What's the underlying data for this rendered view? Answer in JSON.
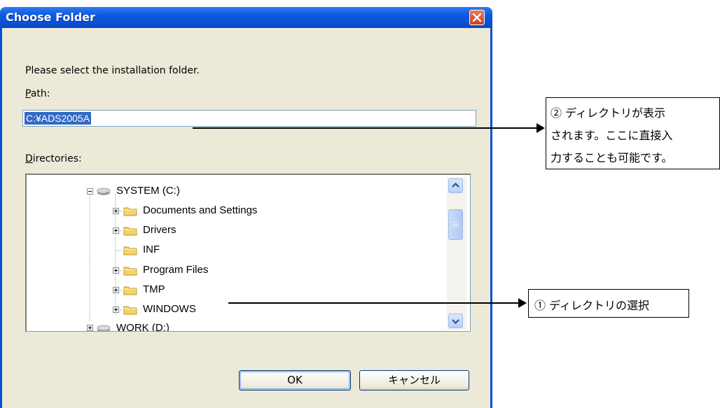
{
  "dialog": {
    "title": "Choose Folder",
    "prompt": "Please select the installation folder.",
    "path_label_accel": "P",
    "path_label_rest": "ath:",
    "path_value": "C:¥ADS2005A",
    "dirs_label_accel": "D",
    "dirs_label_rest": "irectories:",
    "tree": [
      {
        "label": "SYSTEM (C:)",
        "type": "drive",
        "expander": "minus"
      },
      {
        "label": "Documents and Settings",
        "type": "folder",
        "expander": "plus"
      },
      {
        "label": "Drivers",
        "type": "folder",
        "expander": "plus"
      },
      {
        "label": "INF",
        "type": "folder",
        "expander": "none"
      },
      {
        "label": "Program Files",
        "type": "folder",
        "expander": "plus"
      },
      {
        "label": "TMP",
        "type": "folder",
        "expander": "plus"
      },
      {
        "label": "WINDOWS",
        "type": "folder",
        "expander": "plus"
      },
      {
        "label": "WORK (D:)",
        "type": "drive",
        "expander": "plus"
      }
    ],
    "ok_label": "OK",
    "cancel_label": "キャンセル"
  },
  "annotations": {
    "callout_path": [
      "② ディレクトリが表示",
      "されます。ここに直接入",
      "力することも可能です。"
    ],
    "callout_dir": "① ディレクトリの選択"
  },
  "colors": {
    "title_bar": "#0a4fd6",
    "dialog_bg": "#ece9d8",
    "selection": "#316ac5",
    "close_button": "#d9532e"
  },
  "icons": {
    "close": "close-x-icon",
    "drive": "drive-icon",
    "folder": "folder-icon",
    "scroll_up": "scroll-up-arrow-icon",
    "scroll_down": "scroll-down-arrow-icon"
  }
}
